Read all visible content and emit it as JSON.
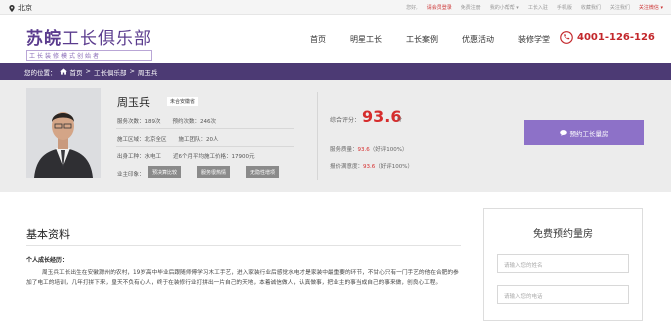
{
  "topbar": {
    "city": "北京",
    "links": [
      "您好,",
      "请会员登录",
      "免费注册",
      "我的小帮帮 ▾",
      "工长入驻",
      "手机版",
      "收藏我们",
      "关注我们"
    ],
    "highlight_link": "请会员登录",
    "extra": "关注微信 ▾"
  },
  "header": {
    "logo_main": "苏皖",
    "logo_sub_main": "工长俱乐部",
    "logo_tagline": "工长装修模式创始者",
    "nav": [
      "首页",
      "明星工长",
      "工长案例",
      "优惠活动",
      "装修学堂"
    ],
    "phone": "4001-126-126"
  },
  "breadcrumb": {
    "prefix": "您的位置：",
    "home": "首页",
    "sep": ">",
    "level1": "工长俱乐部",
    "level2": "周玉兵"
  },
  "profile": {
    "name": "周玉兵",
    "badge": "未合安徽省",
    "service_count_label": "服务次数：189次",
    "booking_count_label": "预约次数：246次",
    "region_label": "施工区域：北京全区",
    "team_label": "施工团队：20人",
    "trade_label": "出身工种：水电工",
    "price_label": "近6个月平均施工价格：17900元",
    "tags_label": "业主印象：",
    "tags": [
      "预决算比较",
      "服务很热情",
      "无隐性增项"
    ],
    "score_label": "综合评分：",
    "score": "93.6",
    "score_unit": "分",
    "quality_label": "服务质量：",
    "quality_value": "93.6",
    "quality_note": "（好评100%）",
    "satisfaction_label": "报价满意度：",
    "satisfaction_value": "93.6",
    "satisfaction_note": "（好评100%）",
    "book_button": "预约工长量房"
  },
  "bio_section": {
    "title": "基本资料",
    "experience_label": "个人成长经历：",
    "bio_text": "周玉兵工长出生在安徽滁州的农村，19岁高中毕业后跟随师傅学习木工手艺，进入家装行业后感觉水电才是家装中最重要的环节，不甘心只有一门手艺的他在合肥的参加了电工的培训，几年打拼下来，皇天不负有心人，终于在装修行业打拼出一片自己的天地，本着诚信做人，认真做事，把业主的事当成自己的事来做，创良心工程。"
  },
  "form": {
    "title": "免费预约量房",
    "name_placeholder": "请输入您的姓名",
    "phone_placeholder": "请输入您的电话"
  },
  "colors": {
    "brand_purple": "#4c3a74",
    "button_purple": "#8d71c8",
    "accent_red": "#d62c2c",
    "phone_red": "#c3272b"
  }
}
